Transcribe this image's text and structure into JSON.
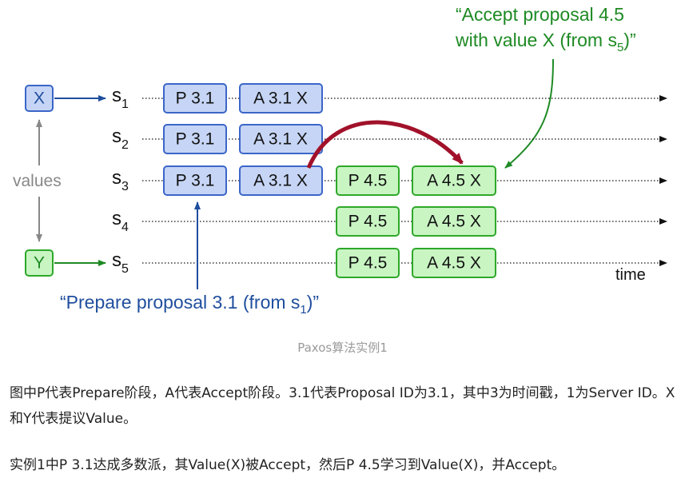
{
  "diagram": {
    "value_x": "X",
    "value_y": "Y",
    "values_label": "values",
    "time_label": "time",
    "servers": [
      {
        "base": "s",
        "sub": "1"
      },
      {
        "base": "s",
        "sub": "2"
      },
      {
        "base": "s",
        "sub": "3"
      },
      {
        "base": "s",
        "sub": "4"
      },
      {
        "base": "s",
        "sub": "5"
      }
    ],
    "prepare_31": "P 3.1",
    "accept_31": "A 3.1 X",
    "prepare_45": "P 4.5",
    "accept_45": "A 4.5 X",
    "note_prepare": {
      "prefix": "“Prepare proposal 3.1 (from s",
      "sub": "1",
      "suffix": ")”"
    },
    "note_accept": {
      "line1": "“Accept proposal 4.5",
      "line2_prefix": "with value X (from s",
      "line2_sub": "5",
      "line2_suffix": ")”"
    },
    "colors": {
      "blue_fill": "#c6d5f5",
      "blue_stroke": "#3a66c8",
      "green_fill": "#c9f5c3",
      "green_stroke": "#2ea82a",
      "arrow_red": "#a1122a"
    }
  },
  "caption": "Paxos算法实例1",
  "paragraphs": {
    "p1": "图中P代表Prepare阶段，A代表Accept阶段。3.1代表Proposal ID为3.1，其中3为时间戳，1为Server ID。X和Y代表提议Value。",
    "p2": "实例1中P 3.1达成多数派，其Value(X)被Accept，然后P 4.5学习到Value(X)，并Accept。"
  }
}
